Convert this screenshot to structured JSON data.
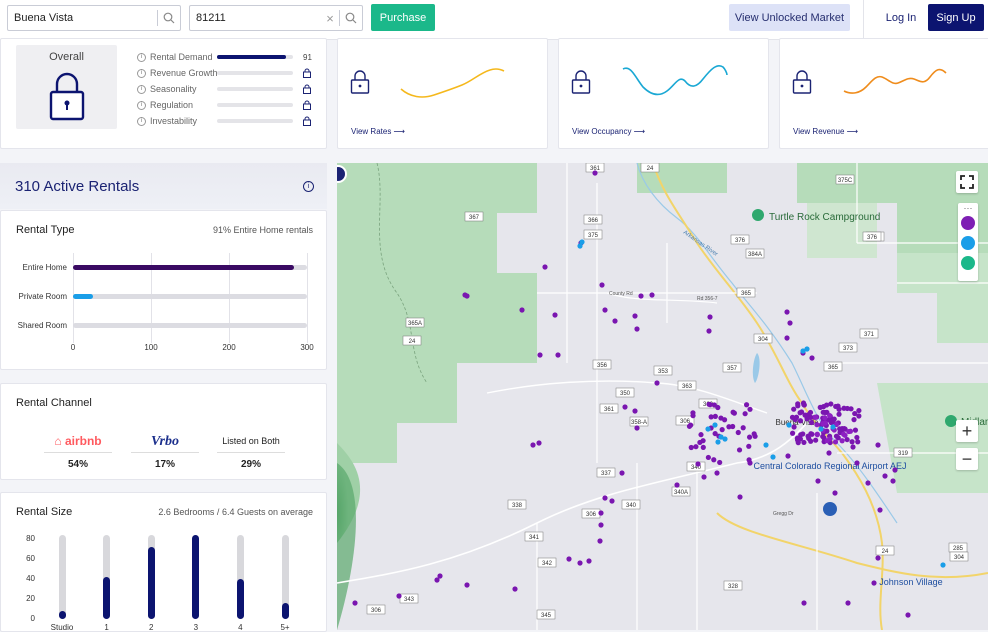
{
  "header": {
    "location_value": "Buena Vista",
    "zip_value": "81211",
    "purchase_label": "Purchase",
    "market_label": "View Unlocked Market",
    "login_label": "Log In",
    "signup_label": "Sign Up"
  },
  "overview": {
    "overall_label": "Overall",
    "metrics": [
      {
        "name": "Rental Demand",
        "value": "91",
        "fill": 0.91,
        "locked": false
      },
      {
        "name": "Revenue Growth",
        "locked": true
      },
      {
        "name": "Seasonality",
        "locked": true
      },
      {
        "name": "Regulation",
        "locked": true
      },
      {
        "name": "Investability",
        "locked": true
      }
    ],
    "cards": [
      {
        "link": "View Rates ⟶",
        "color": "#f5b81c"
      },
      {
        "link": "View Occupancy ⟶",
        "color": "#1aa8d4"
      },
      {
        "link": "View Revenue ⟶",
        "color": "#ef8c1c"
      }
    ]
  },
  "rentals": {
    "title": "310 Active Rentals",
    "rental_type": {
      "title": "Rental Type",
      "note": "91% Entire Home rentals",
      "rows": [
        {
          "label": "Entire Home",
          "value": 283,
          "color": "#3a0a63"
        },
        {
          "label": "Private Room",
          "value": 26,
          "color": "#1a9ee8"
        },
        {
          "label": "Shared Room",
          "value": 0,
          "color": "#3a0a63"
        }
      ],
      "ticks": [
        "0",
        "100",
        "200",
        "300"
      ],
      "xmax": 300
    },
    "rental_channel": {
      "title": "Rental Channel",
      "channels": [
        {
          "name": "airbnb",
          "pct": "54%",
          "color": "#ff5a5f"
        },
        {
          "name": "Vrbo",
          "pct": "17%",
          "color": "#1b2f8c"
        },
        {
          "name": "Listed on Both",
          "pct": "29%",
          "color": "#222"
        }
      ]
    },
    "rental_size": {
      "title": "Rental Size",
      "note": "2.6 Bedrooms / 6.4 Guests on average",
      "yticks": [
        "80",
        "60",
        "40",
        "20",
        "0"
      ],
      "ymax": 88,
      "categories": [
        "Studio",
        "1",
        "2",
        "3",
        "4",
        "5+"
      ],
      "values": [
        8,
        44,
        75,
        88,
        42,
        17
      ]
    }
  },
  "map": {
    "roads": [
      "361",
      "24",
      "367",
      "366",
      "375",
      "376",
      "371",
      "384A",
      "365",
      "365A",
      "24",
      "304",
      "365",
      "356",
      "353",
      "357",
      "363",
      "350",
      "362",
      "361",
      "358-A",
      "306",
      "340",
      "337",
      "340A",
      "338",
      "306",
      "340",
      "341",
      "342",
      "343",
      "328",
      "345",
      "306",
      "319",
      "24",
      "285",
      "304",
      "373",
      "371",
      "376",
      "375C"
    ],
    "places": [
      "Turtle Rock Campground",
      "Midland Hill",
      "Central Colorado Regional Airport AEJ",
      "Johnson Village",
      "Arkansas River",
      "County Rd",
      "Rd 356-7",
      "Gregg Dr",
      "Buena Vista"
    ],
    "zoom_in": "+",
    "zoom_out": "−"
  }
}
